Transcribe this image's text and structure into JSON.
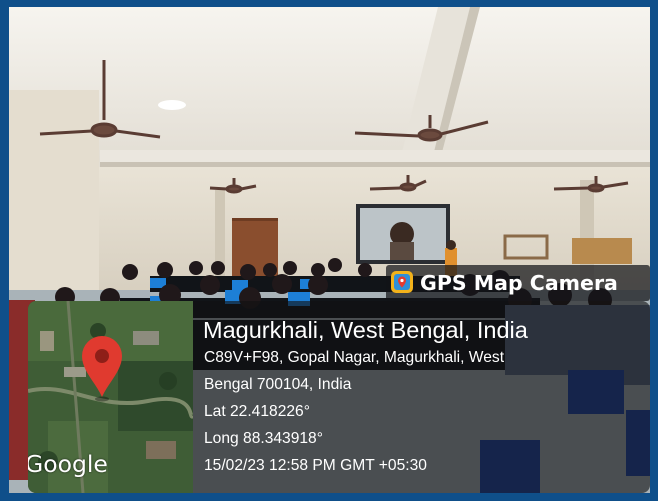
{
  "overlay": {
    "app_name": "GPS Map Camera",
    "location_title": "Magurkhali, West Bengal, India",
    "address_line_1": "C89V+F98, Gopal Nagar, Magurkhali, West",
    "address_line_2": "Bengal 700104, India",
    "latitude": "Lat 22.418226°",
    "longitude": "Long 88.343918°",
    "timestamp": "15/02/23 12:58 PM GMT +05:30",
    "map_provider": "Google"
  },
  "colors": {
    "frame_border": "#0f4f8a",
    "pin": "#e03a2f",
    "overlay_bg": "#101012",
    "text": "#ffffff"
  },
  "icons": {
    "badge": "gps-camera-app-icon",
    "map_pin": "map-pin-icon"
  }
}
